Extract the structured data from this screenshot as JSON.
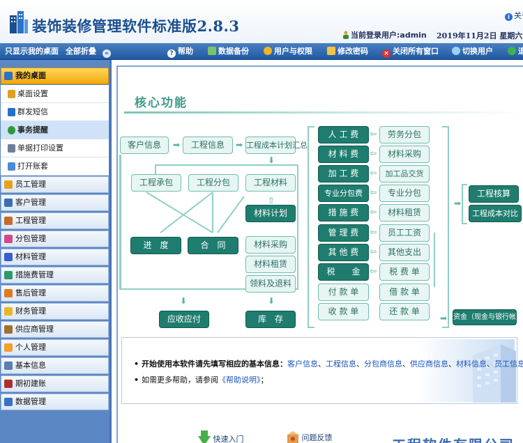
{
  "header": {
    "title": "装饰装修管理软件标准版2.8.3",
    "about_label": "关于",
    "current_user": "当前登录用户:admin",
    "date": "2019年11月2日 星期六 23"
  },
  "toolbar": {
    "show_desktop": "只显示我的桌面",
    "collapse_all": "全部折叠",
    "help": "帮助",
    "backup": "数据备份",
    "users": "用户与权限",
    "password": "修改密码",
    "close_all": "关闭所有窗口",
    "switch_user": "切换用户",
    "exit": "退"
  },
  "sidebar": {
    "desktop_group": "我的桌面",
    "desktop_items": [
      "桌面设置",
      "群发短信",
      "事务提醒",
      "单据打印设置",
      "打开账套"
    ],
    "selected_item": "事务提醒",
    "groups": [
      "员工管理",
      "客户管理",
      "工程管理",
      "分包管理",
      "材料管理",
      "措施费管理",
      "售后管理",
      "财务管理",
      "供应商管理",
      "个人管理",
      "基本信息",
      "期初建账",
      "数据管理"
    ]
  },
  "core": {
    "title": "核心功能",
    "customer_info": "客户信息",
    "project_info": "工程信息",
    "cost_plan_summary": "工程成本计划汇总",
    "contract_out": "工程承包",
    "subcontract": "工程分包",
    "project_material": "工程材料",
    "material_plan": "材料计划",
    "progress": "进　度",
    "contract": "合　同",
    "material_purchase": "材料采购",
    "material_rent": "材料租赁",
    "material_pick_return": "领料及退料",
    "receivables_payables": "应收应付",
    "inventory": "库　存",
    "fees": [
      "人 工 费",
      "材 料 费",
      "加 工 费",
      "专业分包费",
      "措 施 费",
      "管 理 费",
      "其 他 费",
      "税　　金",
      "付 款 单",
      "收 款 单"
    ],
    "fee_details": [
      "劳务分包",
      "材料采购",
      "加工品交货",
      "专业分包",
      "材料租赁",
      "员工工资",
      "其他支出",
      "税 费 单",
      "借 款 单",
      "还 款 单"
    ],
    "project_accounting": "工程核算",
    "cost_compare": "工程成本对比",
    "funds": "资金（现金与银行帐）"
  },
  "info": {
    "line1_prefix": "开始使用本软件请先填写相应的基本信息：",
    "line1_links": [
      "客户信息",
      "工程信息",
      "分包商信息",
      "供应商信息",
      "材料信息",
      "员工信息"
    ],
    "line1_end": ".",
    "line2_prefix": "如需更多帮助，请参阅",
    "line2_link": "《帮助说明》",
    "line2_end": "；"
  },
  "footer": {
    "quick_start": "快速入门",
    "feedback": "问题反馈",
    "company": "工程软件有限公司"
  },
  "colors": {
    "toolbar": "#1f5aa2",
    "sidebar": "#5b87c4",
    "active_group": "#f2a90c",
    "teal_dark": "#1e7d6e",
    "teal_light": "#e8f6f3"
  }
}
